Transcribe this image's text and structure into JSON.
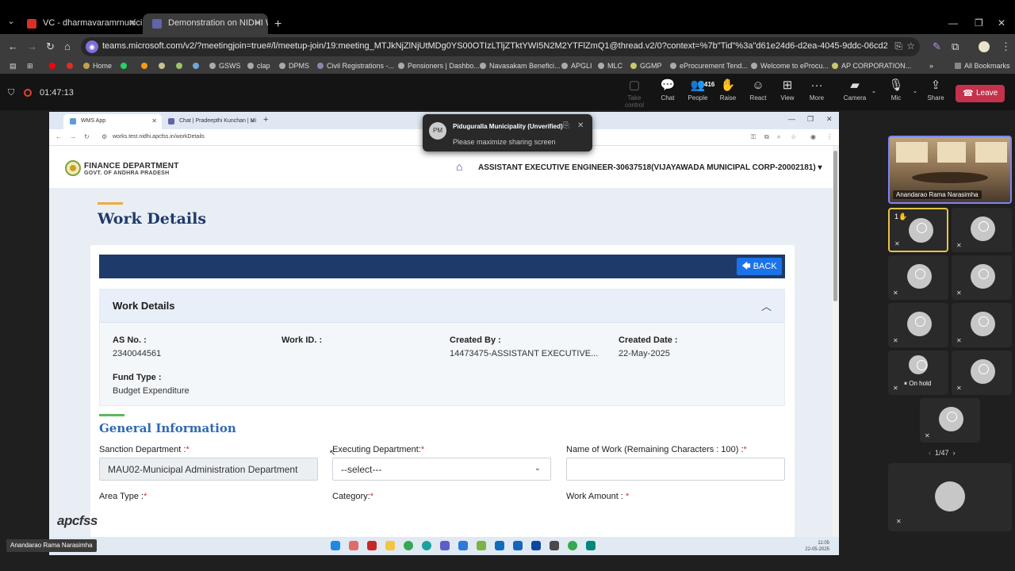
{
  "browser": {
    "tabs": [
      {
        "title": "VC - dharmavaramrnunicipality",
        "close": "✕"
      },
      {
        "title": "Demonstration on NIDHI W",
        "close": "✕"
      }
    ],
    "new_tab": "+",
    "url": "teams.microsoft.com/v2/?meetingjoin=true#/l/meetup-join/19:meeting_MTJkNjZlNjUtMDg0YS00OTIzLTljZTktYWI5N2M2YTFlZmQ1@thread.v2/0?context=%7b\"Tid\"%3a\"d61e24d6-d2ea-4045-9ddc-06cd21e6a149\"%2c\"Oid\"%3a\"7ebd3a85...",
    "bookmarks": [
      "Home",
      "GSWS",
      "clap",
      "DPMS",
      "Civil Registrations -...",
      "Pensioners | Dashbo...",
      "Navasakam Benefici...",
      "APGLI",
      "MLC",
      "GGMP",
      "eProcurement Tend...",
      "Welcome to eProcu...",
      "AP CORPORATION...",
      "All Bookmarks"
    ]
  },
  "teams": {
    "timer": "01:47:13",
    "controls": [
      {
        "label": "Take control",
        "icon": "▢"
      },
      {
        "label": "Chat",
        "icon": "💬"
      },
      {
        "label": "People",
        "icon": "👥",
        "badge": "416"
      },
      {
        "label": "Raise",
        "icon": "✋"
      },
      {
        "label": "React",
        "icon": "☺"
      },
      {
        "label": "View",
        "icon": "⊞"
      },
      {
        "label": "More",
        "icon": "···"
      },
      {
        "label": "Camera",
        "icon": "▰"
      },
      {
        "label": "Mic",
        "icon": "🎙"
      },
      {
        "label": "Share",
        "icon": "⇪"
      }
    ],
    "leave_label": "Leave",
    "notification": {
      "initials": "PM",
      "title": "Piduguralla Municipality (Unverified)",
      "message": "Please maximize sharing screen"
    },
    "presenter_name": "Anandarao Rama Narasimha",
    "self_name": "Anandarao Rama Narasimha",
    "raise_count": "1",
    "on_hold": "On hold",
    "pager": "1/47"
  },
  "shared_screen": {
    "tabs": [
      "WMS App",
      "Chat | Pradeepthi Kunchan | Mi"
    ],
    "url": "works.test.nidhi.apcfss.in/workDetails",
    "dept_line1": "FINANCE DEPARTMENT",
    "dept_line2": "GOVT. OF ANDHRA PRADESH",
    "user": "ASSISTANT EXECUTIVE ENGINEER-30637518(VIJAYAWADA MUNICIPAL CORP-20002181)",
    "page_title": "Work Details",
    "back_label": "BACK",
    "section_title": "Work Details",
    "fields": {
      "as_no_label": "AS No. :",
      "as_no": "2340044561",
      "work_id_label": "Work ID. :",
      "created_by_label": "Created By :",
      "created_by": "14473475-ASSISTANT EXECUTIVE...",
      "created_date_label": "Created Date :",
      "created_date": "22-May-2025",
      "fund_type_label": "Fund Type :",
      "fund_type": "Budget Expenditure"
    },
    "general_info_title": "General Information",
    "form": {
      "sanction_dept_label": "Sanction Department :",
      "sanction_dept_value": "MAU02-Municipal Administration Department",
      "executing_dept_label": "Executing Department:",
      "executing_dept_value": "--select---",
      "name_of_work_label": "Name of Work (Remaining Characters : 100) :",
      "area_type_label": "Area Type :",
      "category_label": "Category:",
      "work_amount_label": "Work Amount : ",
      "required_mark": "*"
    },
    "footer_logo": "apcfss",
    "clock_time": "11:05",
    "clock_date": "22-05-2025"
  }
}
